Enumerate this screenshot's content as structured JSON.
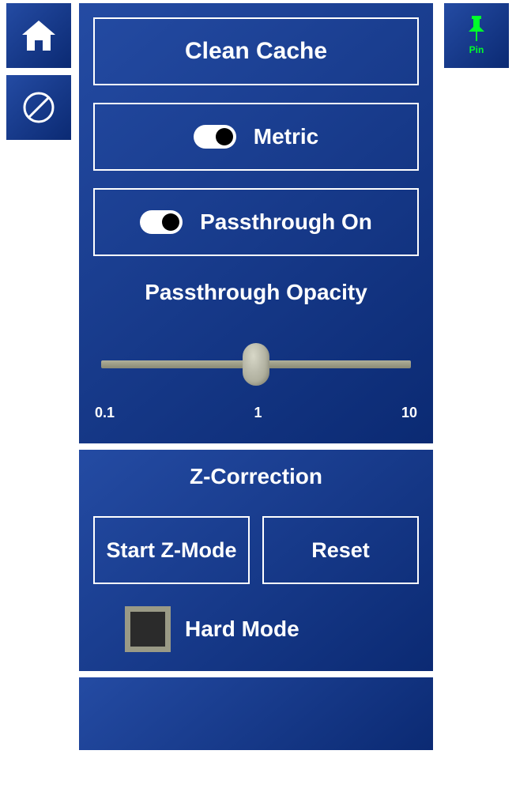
{
  "side": {
    "home_icon": "home",
    "block_icon": "block"
  },
  "pin": {
    "icon": "pin",
    "label": "Pin"
  },
  "main": {
    "clean_cache_label": "Clean Cache",
    "metric": {
      "label": "Metric",
      "on": true
    },
    "passthrough": {
      "label": "Passthrough On",
      "on": true
    },
    "opacity": {
      "title": "Passthrough Opacity",
      "min_label": "0.1",
      "mid_label": "1",
      "max_label": "10",
      "value": 1
    }
  },
  "z": {
    "title": "Z-Correction",
    "start_label": "Start Z-Mode",
    "reset_label": "Reset",
    "hard_mode_label": "Hard Mode",
    "hard_mode_checked": false
  }
}
